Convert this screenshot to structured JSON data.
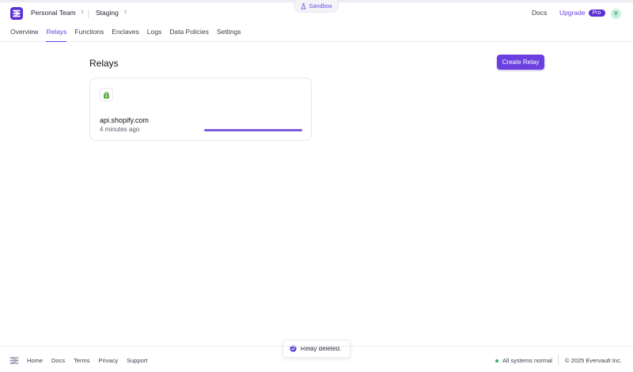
{
  "header": {
    "team": "Personal Team",
    "environment": "Staging",
    "sandbox_label": "Sandbox",
    "docs": "Docs",
    "upgrade": "Upgrade",
    "pro_badge": "Pro",
    "avatar_initial": "B"
  },
  "nav": [
    "Overview",
    "Relays",
    "Functions",
    "Enclaves",
    "Logs",
    "Data Policies",
    "Settings"
  ],
  "nav_active": "Relays",
  "main": {
    "title": "Relays",
    "create_button": "Create Relay",
    "relay": {
      "name": "api.shopify.com",
      "updated": "4 minutes ago",
      "icon": "shopify-icon"
    }
  },
  "toast": {
    "message": "Relay deleted.",
    "icon": "check-circle-icon"
  },
  "footer": {
    "links": [
      "Home",
      "Docs",
      "Terms",
      "Privacy",
      "Support"
    ],
    "status": "All systems normal",
    "copyright": "© 2025 Evervault Inc."
  },
  "colors": {
    "accent": "#6b3fe0",
    "status_ok": "#2fb36b",
    "shopify": "#5aa542"
  }
}
